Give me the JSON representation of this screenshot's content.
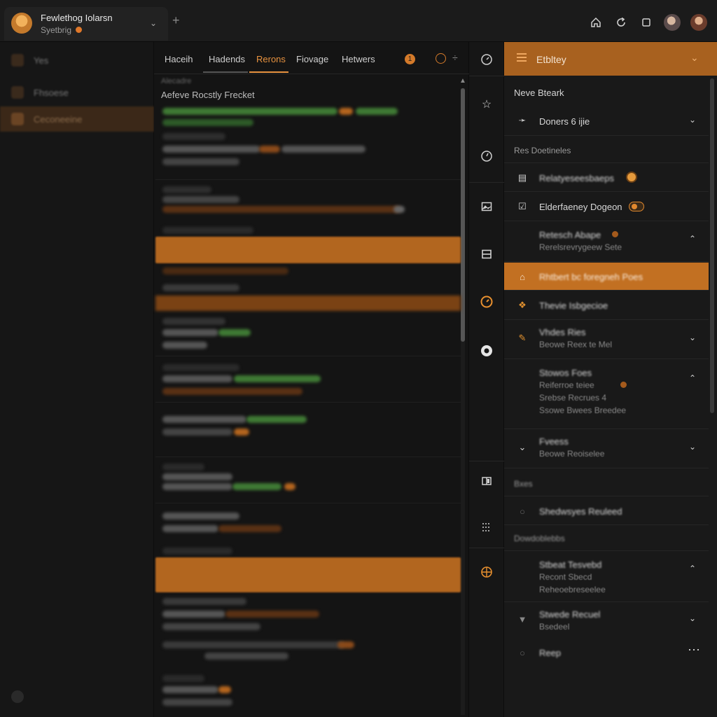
{
  "titlebar": {
    "workspace_title": "Fewlethog Iolarsn",
    "workspace_subtitle": "Syetbrig",
    "status_color": "#e0782a",
    "icons": [
      "home-icon",
      "refresh-icon",
      "window-icon"
    ]
  },
  "sidebar": {
    "items": [
      {
        "label": "Yes"
      },
      {
        "label": "Fhsoese"
      },
      {
        "label": "Ceconeeine"
      }
    ]
  },
  "center": {
    "tabs": [
      {
        "label": "Haceih"
      },
      {
        "label": "Hadends"
      },
      {
        "label": "Rerons"
      },
      {
        "label": "Fiovage"
      },
      {
        "label": "Hetwers"
      }
    ],
    "active_tab": "Rerons",
    "badge": "1",
    "filter_label": "Alecadre",
    "list_heading": "Aefeve Rocstly Frecket"
  },
  "right_panel": {
    "header_title": "Etbltey",
    "section_1": "Neve Bteark",
    "item_doners": "Doners 6 ijie",
    "section_2": "Res Doetineles",
    "item_reltaty": "Relatyeseesbaeps",
    "item_elderfaney": "Elderfaeney Dogeon",
    "item_retesch_1": "Retesch Abape",
    "item_retesch_2": "Rerelsrevrygeew Sete",
    "item_active": "Rhtbert bc foregneh Poes",
    "item_thevie": "Thevie Isbgecioe",
    "item_vhdes_1": "Vhdes Ries",
    "item_vhdes_2": "Beowe Reex te Mel",
    "item_stowos_1": "Stowos Foes",
    "item_stowos_2": "Reiferroe teiee",
    "item_stowos_3": "Srebse Recrues 4",
    "item_stowos_4": "Ssowe Bwees Breedee",
    "item_fveoss_1": "Fveess",
    "item_fveoss_2": "Beowe Reoiselee",
    "section_3": "Bxes",
    "item_shedwsyes": "Shedwsyes Reuleed",
    "section_4": "Dowdoblebbs",
    "item_stbeat_1": "Stbeat Tesvebd",
    "item_stbeat_2": "Recont Sbecd",
    "item_stbeat_3": "Reheoebreseelee",
    "item_stwede_1": "Stwede Recuel",
    "item_stwede_2": "Bsedeel",
    "item_reep": "Reep",
    "accent_color": "#c27022"
  }
}
